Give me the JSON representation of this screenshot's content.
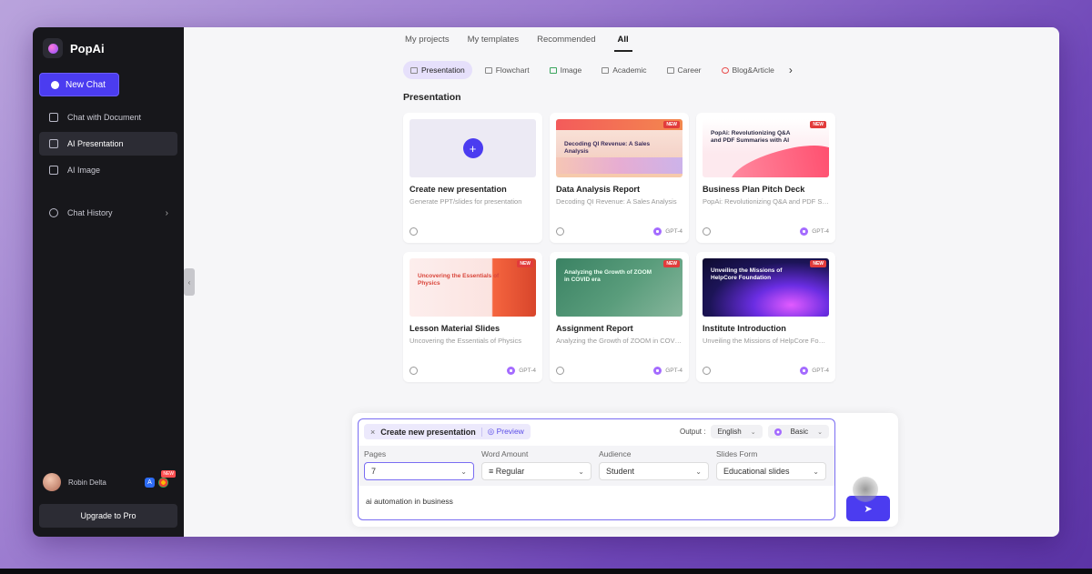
{
  "app": {
    "name": "PopAi"
  },
  "sidebar": {
    "new_chat": "New Chat",
    "items": [
      {
        "label": "Chat with Document"
      },
      {
        "label": "AI Presentation"
      },
      {
        "label": "AI Image"
      }
    ],
    "history": "Chat History",
    "user_name": "Robin Delta",
    "badge": "NEW",
    "upgrade": "Upgrade to Pro"
  },
  "top_tabs": [
    "My projects",
    "My templates",
    "Recommended",
    "All"
  ],
  "categories": [
    "Presentation",
    "Flowchart",
    "Image",
    "Academic",
    "Career",
    "Blog&Article"
  ],
  "section_title": "Presentation",
  "cards": [
    {
      "title": "Create new presentation",
      "sub": "Generate PPT/slides for presentation",
      "thumb_text": "",
      "new": "",
      "model": ""
    },
    {
      "title": "Data Analysis Report",
      "sub": "Decoding QI Revenue: A Sales Analysis",
      "thumb_text": "Decoding QI Revenue: A Sales Analysis",
      "new": "NEW",
      "model": "GPT-4"
    },
    {
      "title": "Business Plan Pitch Deck",
      "sub": "PopAi: Revolutionizing Q&A and PDF Summaries",
      "thumb_text": "PopAi: Revolutionizing Q&A and PDF Summaries with AI",
      "new": "NEW",
      "model": "GPT-4"
    },
    {
      "title": "Lesson Material Slides",
      "sub": "Uncovering the Essentials of Physics",
      "thumb_text": "Uncovering the Essentials of Physics",
      "new": "NEW",
      "model": "GPT-4"
    },
    {
      "title": "Assignment Report",
      "sub": "Analyzing the Growth of ZOOM in COVID era",
      "thumb_text": "Analyzing the Growth of ZOOM in COVID era",
      "new": "NEW",
      "model": "GPT-4"
    },
    {
      "title": "Institute Introduction",
      "sub": "Unveiling the Missions of HelpCore Foundation",
      "thumb_text": "Unveiling the Missions of HelpCore Foundation",
      "new": "NEW",
      "model": "GPT-4"
    }
  ],
  "composer": {
    "chip": "Create new presentation",
    "preview": "Preview",
    "output_label": "Output :",
    "language": "English",
    "mode": "Basic",
    "fields": [
      {
        "label": "Pages",
        "value": "7"
      },
      {
        "label": "Word Amount",
        "value": "Regular"
      },
      {
        "label": "Audience",
        "value": "Student"
      },
      {
        "label": "Slides Form",
        "value": "Educational slides"
      }
    ],
    "prompt": "ai automation in business"
  },
  "colors": {
    "accent": "#4b3cf0",
    "sidebar": "#17171b"
  }
}
